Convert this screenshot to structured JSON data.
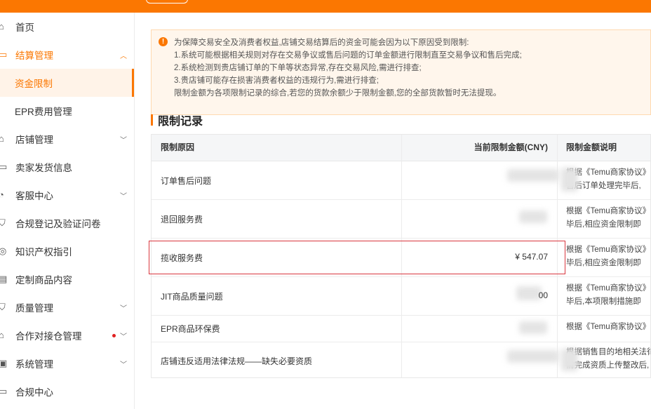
{
  "sidebar": {
    "items": [
      {
        "label": "首页",
        "icon": "home-icon",
        "has_chevron": false
      },
      {
        "label": "结算管理",
        "icon": "settlement-icon",
        "has_chevron": true,
        "chevron": "up"
      },
      {
        "label": "资金限制",
        "sub": true,
        "active": true
      },
      {
        "label": "EPR费用管理",
        "sub": true
      },
      {
        "label": "店铺管理",
        "icon": "shop-icon",
        "has_chevron": true,
        "chevron": "down"
      },
      {
        "label": "卖家发货信息",
        "icon": "shipping-icon",
        "has_chevron": false
      },
      {
        "label": "客服中心",
        "icon": "headset-icon",
        "has_chevron": true,
        "chevron": "down"
      },
      {
        "label": "合规登记及验证问卷",
        "icon": "compliance-icon",
        "has_chevron": false
      },
      {
        "label": "知识产权指引",
        "icon": "ip-icon",
        "has_chevron": false
      },
      {
        "label": "定制商品内容",
        "icon": "custom-icon",
        "has_chevron": false
      },
      {
        "label": "质量管理",
        "icon": "quality-icon",
        "has_chevron": true,
        "chevron": "down"
      },
      {
        "label": "合作对接仓管理",
        "icon": "warehouse-icon",
        "has_chevron": true,
        "chevron": "down",
        "red_dot": true
      },
      {
        "label": "系统管理",
        "icon": "system-icon",
        "has_chevron": true,
        "chevron": "down"
      },
      {
        "label": "合规中心",
        "icon": "compliance-center-icon",
        "has_chevron": false
      }
    ]
  },
  "notice": {
    "lines": [
      "为保障交易安全及消费者权益,店铺交易结算后的资金可能会因为以下原因受到限制:",
      "1.系统可能根据相关规则对存在交易争议或售后问题的订单金额进行限制直至交易争议和售后完成;",
      "2.系统检测到贵店铺订单的下单等状态异常,存在交易风险,需进行排查;",
      "3.贵店铺可能存在损害消费者权益的违规行为,需进行排查;",
      "限制金额为各项限制记录的综合,若您的货款余额少于限制金额,您的全部货款暂时无法提现。"
    ]
  },
  "section": {
    "title": "限制记录"
  },
  "table": {
    "headers": {
      "reason": "限制原因",
      "amount": "当前限制金额(CNY)",
      "desc": "限制金额说明"
    },
    "rows": [
      {
        "reason": "订单售后问题",
        "amount": "",
        "desc1": "根据《Temu商家协议》",
        "desc2": "售后订单处理完毕后,"
      },
      {
        "reason": "退回服务费",
        "amount": "",
        "desc1": "根据《Temu商家协议》",
        "desc2": "毕后,相应资金限制即"
      },
      {
        "reason": "揽收服务费",
        "amount": "¥ 547.07",
        "desc1": "根据《Temu商家协议》",
        "desc2": "毕后,相应资金限制即"
      },
      {
        "reason": "JIT商品质量问题",
        "amount": "00",
        "desc1": "根据《Temu商家协议》",
        "desc2": "毕后,本项限制措施即"
      },
      {
        "reason": "EPR商品环保费",
        "amount": "",
        "desc1": "根据《Temu商家协议》",
        "desc2": ""
      },
      {
        "reason": "店铺违反适用法律法规——缺失必要资质",
        "amount": "",
        "desc1": "根据销售目的地相关法律",
        "desc2": "需完成资质上传整改后,"
      }
    ]
  },
  "colors": {
    "accent": "#fb7701",
    "highlight": "#d9363e"
  }
}
